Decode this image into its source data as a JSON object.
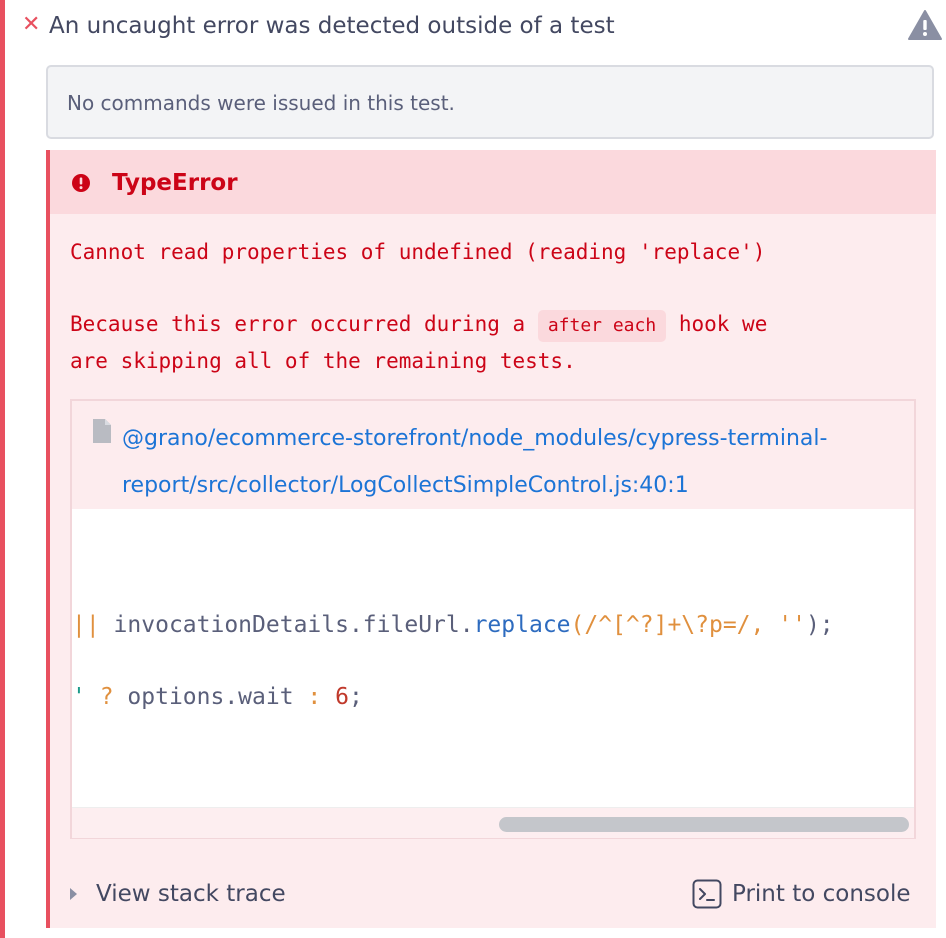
{
  "header": {
    "title": "An uncaught error was detected outside of a test",
    "close_icon": "x-icon",
    "warning_icon": "warning-triangle-icon",
    "accent_color": "#e8505f"
  },
  "commands": {
    "message": "No commands were issued in this test."
  },
  "error": {
    "name": "TypeError",
    "message_line1": "Cannot read properties of undefined (reading 'replace')",
    "message_line2_prefix": "Because this error occurred during a",
    "hook_name": "after each",
    "message_line2_suffix": "hook we",
    "message_line3": "are skipping all of the remaining tests.",
    "color": "#cc0417"
  },
  "code_frame": {
    "file_path_line1": "@grano/ecommerce-storefront/node_modules/cypress-terminal-",
    "file_path_line2": "report/src/collector/LogCollectSimpleControl.js:40:1",
    "line1": {
      "op": "||",
      "obj": " invocationDetails.fileUrl.",
      "fn": "replace",
      "regex": "(/^[^?]+\\?p=/,",
      "str": " ''",
      "end": ");"
    },
    "line2": {
      "quote": "'",
      "q": " ?",
      "expr": " options.wait",
      "colon": " :",
      "num": " 6",
      "end": ";"
    }
  },
  "footer": {
    "view_stack_trace": "View stack trace",
    "print_to_console": "Print to console"
  }
}
